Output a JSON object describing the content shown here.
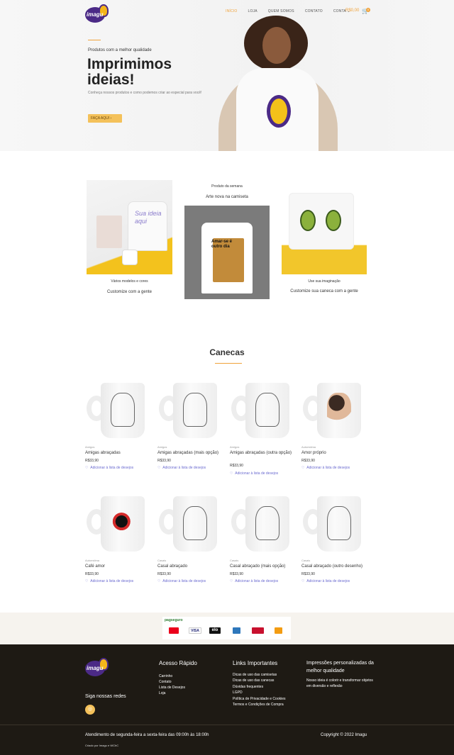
{
  "header": {
    "logo_text": "imagu",
    "nav": [
      "INÍCIO",
      "LOJA",
      "QUEM SOMOS",
      "CONTATO",
      "CONTA"
    ],
    "cart_total": "R$0,00",
    "cart_count": "0"
  },
  "hero": {
    "subtitle": "Produtos com a melhor qualidade",
    "title": "Imprimimos ideias!",
    "description": "Conheça nossos produtos e como podemos criar ao especial para você!",
    "button": "FAÇA AQUI"
  },
  "promos": {
    "left_small": "Vários modelos e cores",
    "left_bold": "Customize com a gente",
    "center_small": "Produto da semana",
    "center_bold": "Arte nova na camiseta",
    "right_small": "Use sua imaginação",
    "right_bold": "Customize sua caneca com a gente",
    "bag_text": "Sua ideia aqui",
    "shirt_text": "Amar-se é outro dia"
  },
  "catalog": {
    "title": "Canecas",
    "wishlist_label": "Adicionar à lista de desejos",
    "products": [
      {
        "category": "Amigos",
        "name": "Amigas abraçadas",
        "price": "R$33,90"
      },
      {
        "category": "Amigos",
        "name": "Amigas abraçadas (mais opção)",
        "price": "R$33,90"
      },
      {
        "category": "Amigos",
        "name": "Amigas abraçadas (outra opção)",
        "price": "R$33,90"
      },
      {
        "category": "Autoestima",
        "name": "Amor próprio",
        "price": "R$33,90"
      },
      {
        "category": "Autoestima",
        "name": "Café amor",
        "price": "R$33,90"
      },
      {
        "category": "Casais",
        "name": "Casal abraçado",
        "price": "R$33,90"
      },
      {
        "category": "Casais",
        "name": "Casal abraçado (mais opção)",
        "price": "R$33,90"
      },
      {
        "category": "Casais",
        "name": "Casal abraçado (outro desenho)",
        "price": "R$33,90"
      }
    ]
  },
  "payment": {
    "provider": "pagseguro",
    "cards": [
      "mastercard",
      "VISA",
      "elo",
      "amex",
      "hipercard",
      "diners"
    ]
  },
  "footer": {
    "social_title": "Siga nossas redes",
    "quick_title": "Acesso Rápido",
    "quick_links": [
      "Carrinho",
      "Contato",
      "Lista de Desejos",
      "Loja"
    ],
    "important_title": "Links Importantes",
    "important_links": [
      "Dicas de uso das camisetas",
      "Dicas de uso das canecas",
      "Dúvidas frequentes",
      "LGPD",
      "Política de Privacidade e Cookies",
      "Termos e Condições de Compra"
    ],
    "about_title": "Impressões personalizadas da melhor qualidade",
    "about_text": "Nosso ideia é colorir e transformar objetos em diversão e reflexão",
    "hours": "Atendimento de segunda-feira a sexta-feira das 09:00h às 18:00h",
    "copyright": "Copyright © 2022 Imagu",
    "credits": "Criado por Imagu e WChC"
  },
  "colors": {
    "accent": "#f0a23a",
    "brand_purple": "#4b2a86",
    "brand_yellow": "#f4c11a",
    "footer_bg": "#1e1a14"
  }
}
